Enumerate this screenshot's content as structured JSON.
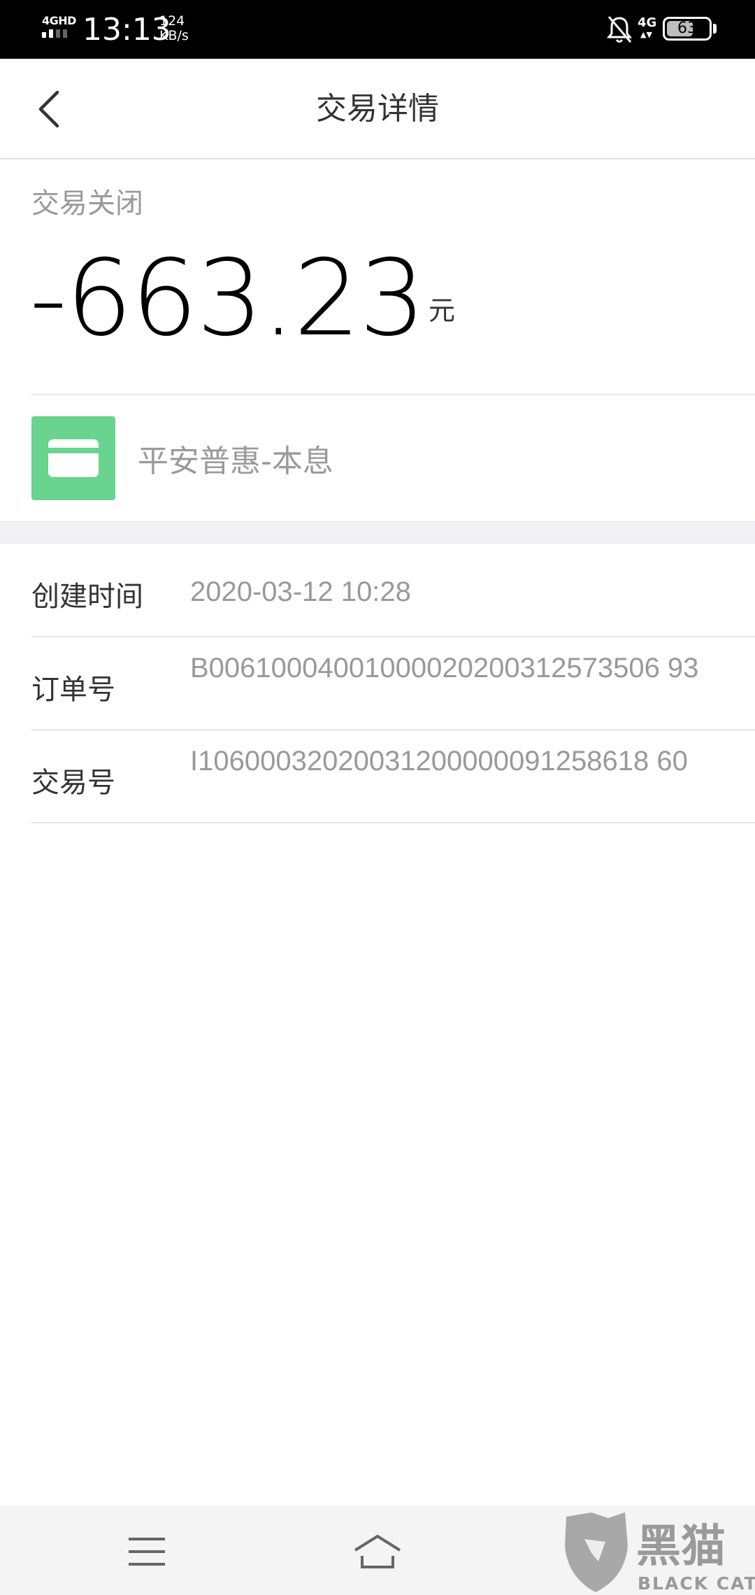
{
  "status_bar": {
    "network": "4GHD",
    "time": "13:13",
    "speed_value": "124",
    "speed_unit": "KB/s",
    "mobile_data": "4G",
    "battery": "63",
    "battery_level": 0.63
  },
  "header": {
    "title": "交易详情",
    "back_icon": "chevron-left-icon"
  },
  "summary": {
    "status": "交易关闭",
    "amount": "-663.23",
    "unit": "元"
  },
  "source": {
    "icon": "bank-card-icon",
    "icon_color": "#68d48f",
    "label": "平安普惠-本息"
  },
  "details": [
    {
      "label": "创建时间",
      "value": "2020-03-12 10:28"
    },
    {
      "label": "订单号",
      "value": "B00610004001000020200312573506 93"
    },
    {
      "label": "交易号",
      "value": "I10600032020031200000091258618 60"
    }
  ],
  "nav": {
    "menu_icon": "menu-icon",
    "home_icon": "home-icon"
  },
  "watermark": {
    "name": "黑猫",
    "brand": "BLACK CAT"
  }
}
